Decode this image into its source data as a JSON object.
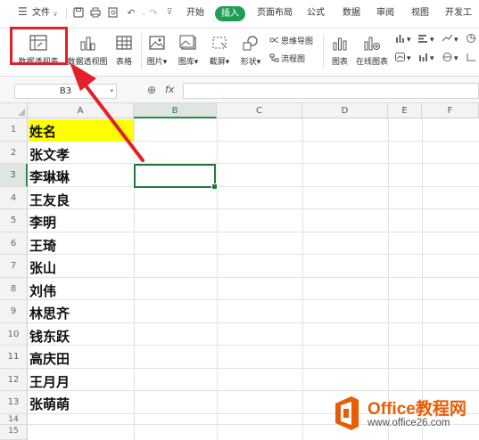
{
  "menubar": {
    "file": "文件",
    "tabs": [
      "开始",
      "插入",
      "页面布局",
      "公式",
      "数据",
      "审阅",
      "视图",
      "开发工"
    ],
    "active_tab": "插入"
  },
  "ribbon": {
    "pivot_table": "数据透视表",
    "pivot_chart": "数据透视图",
    "table": "表格",
    "picture": "图片",
    "gallery": "图库",
    "screenshot": "截屏",
    "shapes": "形状",
    "mindmap": "思维导图",
    "flowchart": "流程图",
    "chart": "图表",
    "online_chart": "在线图表"
  },
  "formula_bar": {
    "name_box": "B3",
    "fx": "fx",
    "value": ""
  },
  "sheet": {
    "columns": [
      "A",
      "B",
      "C",
      "D",
      "E",
      "F"
    ],
    "selected_column": "B",
    "rows": [
      "1",
      "2",
      "3",
      "4",
      "5",
      "6",
      "7",
      "8",
      "9",
      "10",
      "11",
      "12",
      "13",
      "14",
      "15"
    ],
    "selected_row": "3",
    "column_a": [
      "姓名",
      "张文孝",
      "李琳琳",
      "王友良",
      "李明",
      "王琦",
      "张山",
      "刘伟",
      "林思齐",
      "钱东跃",
      "高庆田",
      "王月月",
      "张萌萌"
    ],
    "header_fill_color": "#ffff00",
    "selection_color": "#217a3c"
  },
  "annotation": {
    "color": "#e3202a"
  },
  "watermark": {
    "brand": "Office教程网",
    "url": "www.office26.com",
    "color": "#e85d04"
  }
}
